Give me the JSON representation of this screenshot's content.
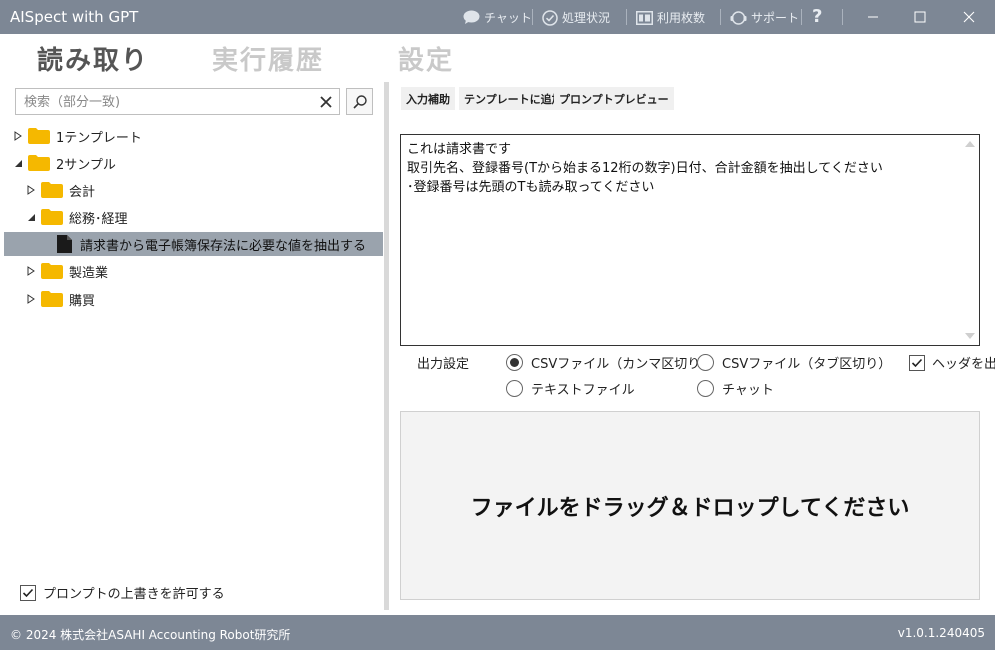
{
  "window": {
    "title": "AISpect with GPT",
    "menu": [
      {
        "label": "チャット",
        "icon": "chat-icon"
      },
      {
        "label": "処理状況",
        "icon": "check-circle-icon"
      },
      {
        "label": "利用枚数",
        "icon": "counter-icon"
      },
      {
        "label": "サポート",
        "icon": "support-icon"
      }
    ],
    "help_label": "?"
  },
  "tabs": [
    {
      "label": "読み取り",
      "active": true
    },
    {
      "label": "実行履歴",
      "active": false
    },
    {
      "label": "設定",
      "active": false
    }
  ],
  "search": {
    "placeholder": "検索（部分一致)",
    "value": ""
  },
  "tree": [
    {
      "label": "1テンプレート",
      "level": 0,
      "type": "folder",
      "expanded": false
    },
    {
      "label": "2サンプル",
      "level": 0,
      "type": "folder",
      "expanded": true
    },
    {
      "label": "会計",
      "level": 1,
      "type": "folder",
      "expanded": false
    },
    {
      "label": "総務･経理",
      "level": 1,
      "type": "folder",
      "expanded": true
    },
    {
      "label": "請求書から電子帳簿保存法に必要な値を抽出する",
      "level": 2,
      "type": "file",
      "selected": true
    },
    {
      "label": "製造業",
      "level": 1,
      "type": "folder",
      "expanded": false
    },
    {
      "label": "購買",
      "level": 1,
      "type": "folder",
      "expanded": false
    }
  ],
  "allow_overwrite": {
    "label": "プロンプトの上書きを許可する",
    "checked": true
  },
  "toolbar": {
    "input_assist": "入力補助",
    "add_template": "テンプレートに追加",
    "prompt_preview": "プロンプトプレビュー"
  },
  "prompt": {
    "lines": [
      "これは請求書です",
      "取引先名、登録番号(Tから始まる12桁の数字)日付、合計金額を抽出してください",
      "･登録番号は先頭のTも読み取ってください"
    ]
  },
  "output": {
    "label": "出力設定",
    "options": [
      {
        "label": "CSVファイル（カンマ区切り）",
        "selected": true
      },
      {
        "label": "CSVファイル（タブ区切り）",
        "selected": false
      },
      {
        "label": "テキストファイル",
        "selected": false
      },
      {
        "label": "チャット",
        "selected": false
      }
    ],
    "header_option": {
      "label": "ヘッダを出",
      "checked": true
    }
  },
  "drop_zone": {
    "label": "ファイルをドラッグ＆ドロップしてください"
  },
  "footer": {
    "copyright": "© 2024 株式会社ASAHI Accounting Robot研究所",
    "version": "v1.0.1.240405"
  },
  "colors": {
    "titlebar": "#7d8795",
    "selected_row": "#9aa3ad",
    "folder": "#f5b800"
  }
}
